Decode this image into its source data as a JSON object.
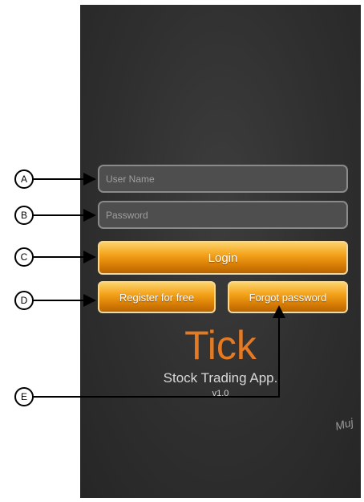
{
  "login_form": {
    "username_placeholder": "User Name",
    "password_placeholder": "Password",
    "login_label": "Login",
    "register_label": "Register for free",
    "forgot_label": "Forgot password"
  },
  "branding": {
    "app_name": "Tick",
    "tagline": "Stock Trading App.",
    "version": "v1.0",
    "signature": "Muj"
  },
  "callouts": [
    "A",
    "B",
    "C",
    "D",
    "E"
  ],
  "colors": {
    "screen_background": "#2f2f2f",
    "button_orange": "#f4a21a",
    "app_name_orange": "#e67a22"
  }
}
